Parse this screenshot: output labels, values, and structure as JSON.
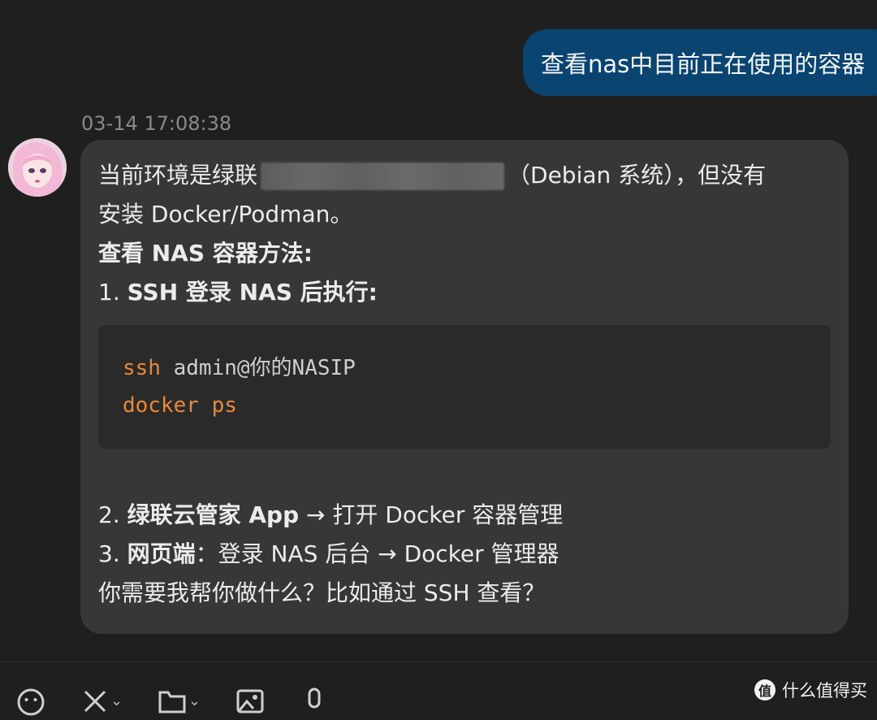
{
  "user_message": {
    "text": "查看nas中目前正在使用的容器"
  },
  "assistant_message": {
    "timestamp": "03-14 17:08:38",
    "intro_before_redact": "当前环境是绿联",
    "intro_after_redact": "（Debian 系统），但没有",
    "intro_line2": "安装 Docker/Podman。",
    "heading": "查看 NAS 容器方法:",
    "step1_num": "1.",
    "step1_text": "SSH 登录 NAS 后执行:",
    "code": {
      "line1_cmd": "ssh",
      "line1_arg": " admin@你的NASIP",
      "line2_cmd": "docker ps"
    },
    "step2_num": "2.",
    "step2_bold": "绿联云管家 App",
    "step2_rest": " → 打开 Docker 容器管理",
    "step3_num": "3.",
    "step3_bold": "网页端",
    "step3_rest": "：登录 NAS 后台 → Docker 管理器",
    "closing": "你需要我帮你做什么？比如通过 SSH 查看？"
  },
  "toolbar": {
    "icons": [
      "emoji-icon",
      "tools-icon",
      "folder-icon",
      "image-icon",
      "microphone-icon"
    ]
  },
  "watermark": {
    "logo": "值",
    "text": "什么值得买"
  }
}
